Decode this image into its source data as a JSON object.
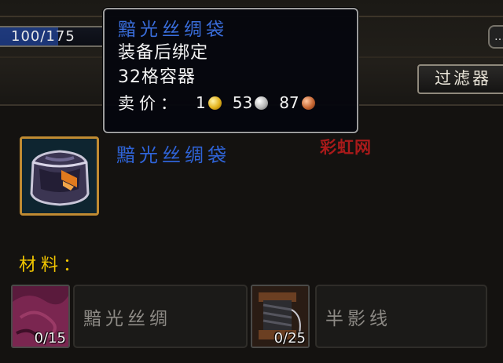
{
  "skill": {
    "progress": "100/175",
    "current": 100,
    "max": 175
  },
  "chat": {
    "icon": "speech-bubble-icon"
  },
  "filter": {
    "label": "过滤器"
  },
  "tooltip": {
    "title": "黯光丝绸袋",
    "bind": "装备后绑定",
    "container": "32格容器",
    "sell_label": "卖价：",
    "gold": "1",
    "silver": "53",
    "copper": "87"
  },
  "item": {
    "name": "黯光丝绸袋",
    "icon": "purple-bag-icon"
  },
  "watermark": "彩虹网",
  "materials": {
    "title": "材料：",
    "reagents": [
      {
        "name": "黯光丝绸",
        "count": "0/15",
        "icon": "purple-silk-icon"
      },
      {
        "name": "半影线",
        "count": "0/25",
        "icon": "thread-spool-icon"
      }
    ]
  },
  "colors": {
    "item_blue": "#2f64d8",
    "materials_gold": "#f2c600",
    "icon_border": "#c08b32"
  }
}
